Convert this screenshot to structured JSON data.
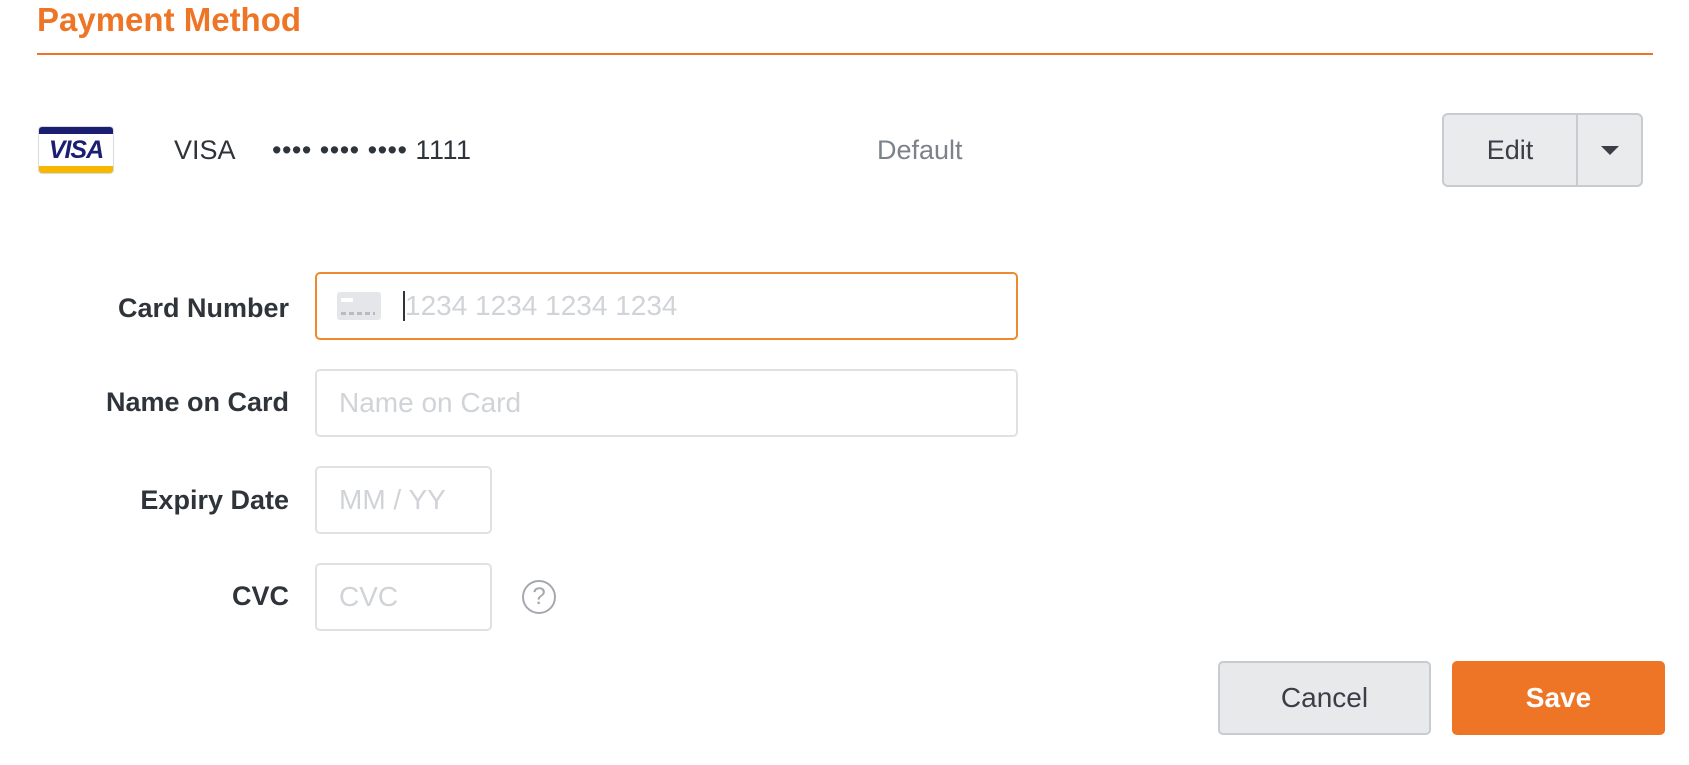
{
  "section": {
    "title": "Payment Method"
  },
  "saved_card": {
    "logo_text": "VISA",
    "brand": "VISA",
    "masked_number": "•••• •••• •••• 1111",
    "status": "Default",
    "edit_label": "Edit"
  },
  "form": {
    "card_number": {
      "label": "Card Number",
      "placeholder": "1234 1234 1234 1234",
      "value": ""
    },
    "name_on_card": {
      "label": "Name on Card",
      "placeholder": "Name on Card",
      "value": ""
    },
    "expiry": {
      "label": "Expiry Date",
      "placeholder": "MM / YY",
      "value": ""
    },
    "cvc": {
      "label": "CVC",
      "placeholder": "CVC",
      "value": "",
      "help_glyph": "?"
    }
  },
  "actions": {
    "cancel_label": "Cancel",
    "save_label": "Save"
  },
  "colors": {
    "accent": "#ee7526",
    "visa_blue": "#1a1f71",
    "visa_gold": "#f7b600",
    "focus_border": "#ee8a2e"
  },
  "icons": {
    "card_field": "credit-card-icon",
    "dropdown": "chevron-down-icon",
    "help": "question-circle-icon"
  }
}
